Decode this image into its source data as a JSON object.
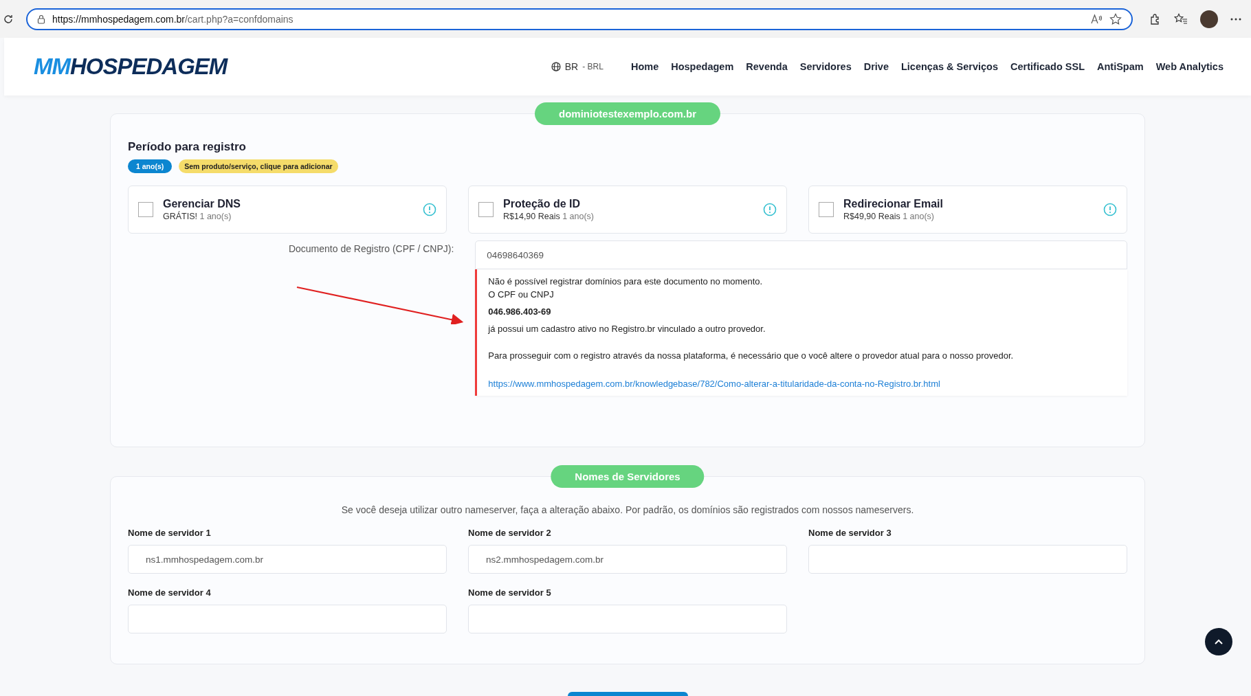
{
  "browser": {
    "url_host": "https://mmhospedagem.com.br",
    "url_path": "/cart.php?a=confdomains"
  },
  "header": {
    "logo_primary": "MM",
    "logo_secondary": "HOSPEDAGEM",
    "locale": "BR",
    "currency": "- BRL",
    "nav": [
      "Home",
      "Hospedagem",
      "Revenda",
      "Servidores",
      "Drive",
      "Licenças & Serviços",
      "Certificado SSL",
      "AntiSpam",
      "Web Analytics"
    ]
  },
  "domain_card": {
    "domain": "dominiotestexemplo.com.br",
    "period_title": "Período para registro",
    "badges": [
      {
        "label": "1 ano(s)",
        "kind": "period"
      },
      {
        "label": "Sem produto/serviço, clique para adicionar",
        "kind": "notice"
      }
    ],
    "addons": [
      {
        "name": "Gerenciar DNS",
        "price": "GRÁTIS!",
        "term": "1 ano(s)",
        "checked": false
      },
      {
        "name": "Proteção de ID",
        "price": "R$14,90 Reais",
        "term": "1 ano(s)",
        "checked": false
      },
      {
        "name": "Redirecionar Email",
        "price": "R$49,90 Reais",
        "term": "1 ano(s)",
        "checked": false
      }
    ],
    "document_label": "Documento de Registro (CPF / CNPJ):",
    "document_value": "04698640369",
    "error": {
      "line1": "Não é possível registrar domínios para este documento no momento.",
      "line2": "O CPF ou CNPJ",
      "document": "046.986.403-69",
      "line3": "já possui um cadastro ativo no Registro.br vinculado a outro provedor.",
      "line4": "Para prosseguir com o registro através da nossa plataforma, é necessário que o você altere o provedor atual para o nosso provedor.",
      "link": "https://www.mmhospedagem.com.br/knowledgebase/782/Como-alterar-a-titularidade-da-conta-no-Registro.br.html"
    }
  },
  "nameservers_card": {
    "title": "Nomes de Servidores",
    "description": "Se você deseja utilizar outro nameserver, faça a alteração abaixo. Por padrão, os domínios são registrados com nossos nameservers.",
    "fields": [
      {
        "label": "Nome de servidor 1",
        "value": "ns1.mmhospedagem.com.br"
      },
      {
        "label": "Nome de servidor 2",
        "value": "ns2.mmhospedagem.com.br"
      },
      {
        "label": "Nome de servidor 3"
      },
      {
        "label": "Nome de servidor 4"
      },
      {
        "label": "Nome de servidor 5"
      }
    ]
  }
}
